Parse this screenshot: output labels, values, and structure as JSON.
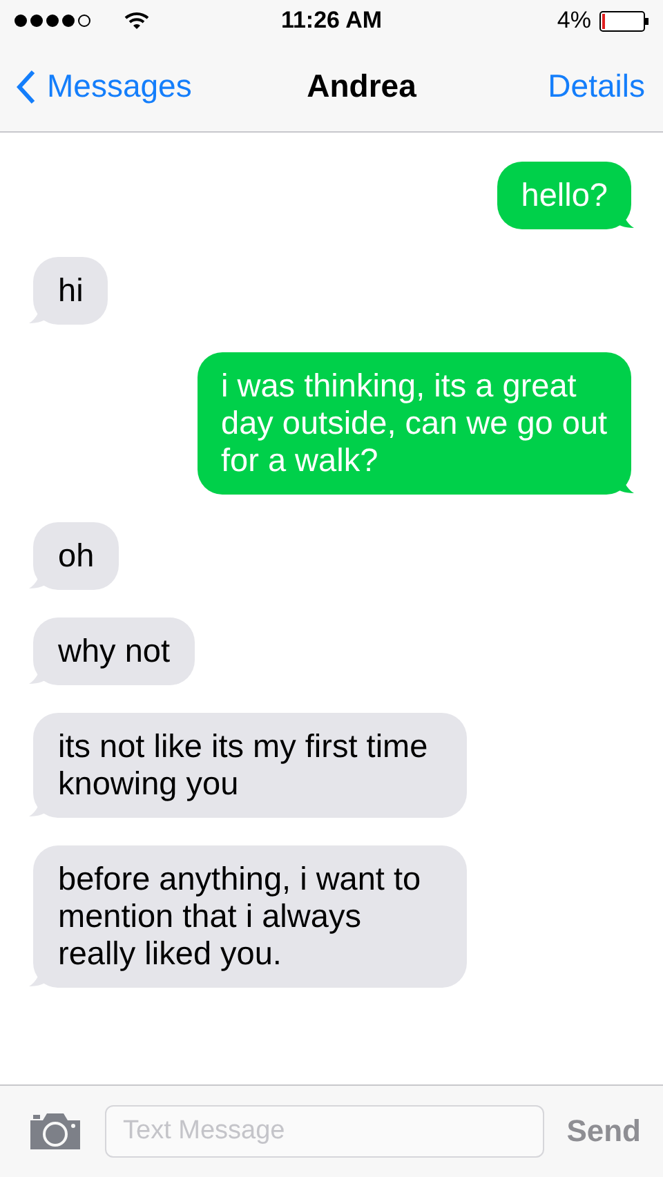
{
  "status_bar": {
    "time": "11:26 AM",
    "battery_text": "4%"
  },
  "nav": {
    "back": "Messages",
    "title": "Andrea",
    "action": "Details"
  },
  "messages": [
    {
      "kind": "sent",
      "text": "hello?"
    },
    {
      "kind": "received",
      "text": "hi"
    },
    {
      "kind": "sent",
      "text": "i was thinking, its a great day outside, can we go out for a walk?"
    },
    {
      "kind": "received",
      "text": "oh"
    },
    {
      "kind": "received",
      "text": "why not"
    },
    {
      "kind": "received",
      "text": "its not like its my first time knowing you"
    },
    {
      "kind": "received",
      "text": "before anything, i want to mention that i always really liked you."
    }
  ],
  "composer": {
    "placeholder": "Text Message",
    "send": "Send",
    "send_disabled": true
  }
}
